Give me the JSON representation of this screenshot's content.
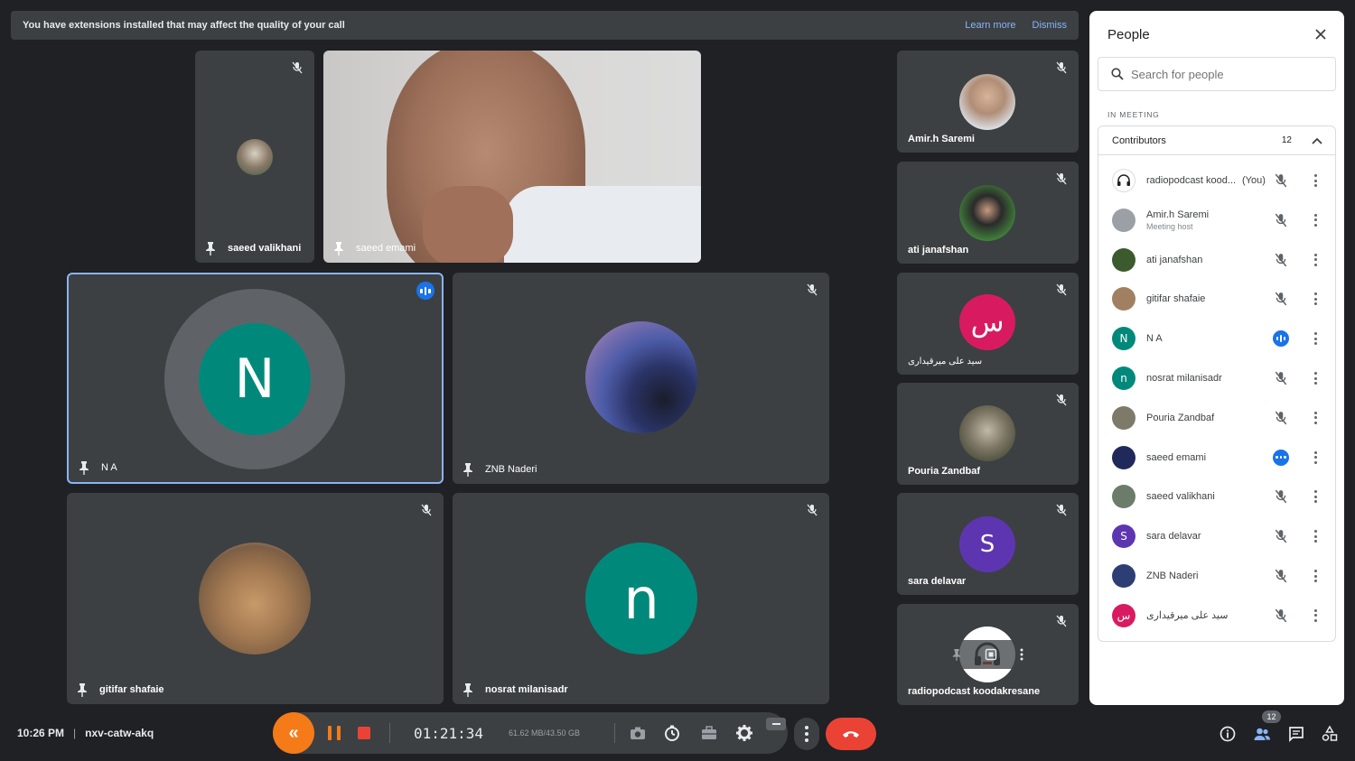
{
  "banner": {
    "message": "You have extensions installed that may affect the quality of your call",
    "learn_more": "Learn more",
    "dismiss": "Dismiss"
  },
  "tiles": {
    "saeed_valikhani": "saeed valikhani",
    "saeed_emami": "saeed emami",
    "na": "N A",
    "na_initial": "N",
    "znb_naderi": "ZNB Naderi",
    "gitifar": "gitifar shafaie",
    "nosrat": "nosrat milanisadr",
    "nosrat_initial": "n"
  },
  "side_tiles": {
    "amir": "Amir.h Saremi",
    "ati": "ati janafshan",
    "seyed": "سید علی میرقیداری",
    "seyed_initial": "س",
    "pouria": "Pouria Zandbaf",
    "sara": "sara delavar",
    "sara_initial": "S",
    "radio": "radiopodcast koodakresane"
  },
  "panel": {
    "title": "People",
    "search_placeholder": "Search for people",
    "section": "IN MEETING",
    "contributors_label": "Contributors",
    "contributors_count": "12",
    "people": [
      {
        "name": "radiopodcast kood...",
        "suffix": "(You)",
        "initial": "",
        "color": "#ffffff",
        "status": "muted"
      },
      {
        "name": "Amir.h Saremi",
        "sub": "Meeting host",
        "initial": "",
        "color": "#9aa0a6",
        "status": "muted"
      },
      {
        "name": "ati janafshan",
        "initial": "",
        "color": "#3b5b2e",
        "status": "muted"
      },
      {
        "name": "gitifar shafaie",
        "initial": "",
        "color": "#a08060",
        "status": "muted"
      },
      {
        "name": "N A",
        "initial": "N",
        "color": "#00897b",
        "status": "speaking"
      },
      {
        "name": "nosrat milanisadr",
        "initial": "n",
        "color": "#00897b",
        "status": "muted"
      },
      {
        "name": "Pouria Zandbaf",
        "initial": "",
        "color": "#7d7a6a",
        "status": "muted"
      },
      {
        "name": "saeed emami",
        "initial": "",
        "color": "#1f2a5a",
        "status": "more"
      },
      {
        "name": "saeed valikhani",
        "initial": "",
        "color": "#6b7d6a",
        "status": "muted"
      },
      {
        "name": "sara delavar",
        "initial": "S",
        "color": "#5e35b1",
        "status": "muted"
      },
      {
        "name": "ZNB Naderi",
        "initial": "",
        "color": "#2d3e74",
        "status": "muted"
      },
      {
        "name": "سید علی میرقیداری",
        "initial": "س",
        "color": "#d81b60",
        "status": "muted"
      }
    ]
  },
  "bottom": {
    "time": "10:26 PM",
    "separator": "|",
    "meeting_code": "nxv-catw-akq",
    "participants_badge": "12"
  },
  "recorder": {
    "elapsed": "01:21:34",
    "size": "61.62 MB/43.50 GB",
    "rewind_glyph": "«"
  },
  "colors": {
    "bg": "#202124",
    "tile": "#3c4043",
    "accent_blue": "#1a73e8",
    "hangup_red": "#ea4335",
    "recorder_orange": "#f57a18",
    "teal": "#00897b"
  }
}
